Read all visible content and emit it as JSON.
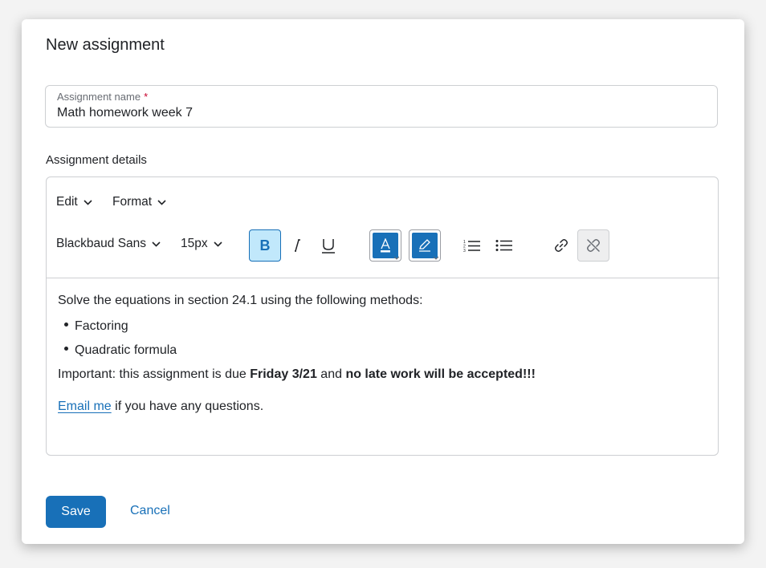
{
  "dialog": {
    "title": "New assignment"
  },
  "assignment_name": {
    "label": "Assignment name",
    "required_mark": "*",
    "value": "Math homework week 7"
  },
  "details": {
    "label": "Assignment details"
  },
  "editor": {
    "menus": [
      {
        "label": "Edit"
      },
      {
        "label": "Format"
      }
    ],
    "font_family": "Blackbaud Sans",
    "font_size": "15px",
    "bold_label": "B",
    "toolbar_icons": [
      "bold-icon",
      "italic-icon",
      "underline-icon",
      "font-color-icon",
      "highlight-color-icon",
      "numbered-list-icon",
      "bulleted-list-icon",
      "link-icon",
      "unlink-icon"
    ],
    "active_swatch_color": "#1870b8"
  },
  "content": {
    "intro": "Solve the equations in section 24.1 using the following methods:",
    "list": [
      "Factoring",
      "Quadratic formula"
    ],
    "important_prefix": "Important: this assignment is due ",
    "due_date": "Friday 3/21",
    "important_mid": " and ",
    "late_policy": "no late work will be accepted!!!",
    "email_link": "Email me",
    "email_suffix": " if you have any questions."
  },
  "actions": {
    "save": "Save",
    "cancel": "Cancel"
  },
  "colors": {
    "accent": "#1870b8",
    "required": "#c7002c",
    "active_bg": "#c1e8fb"
  }
}
